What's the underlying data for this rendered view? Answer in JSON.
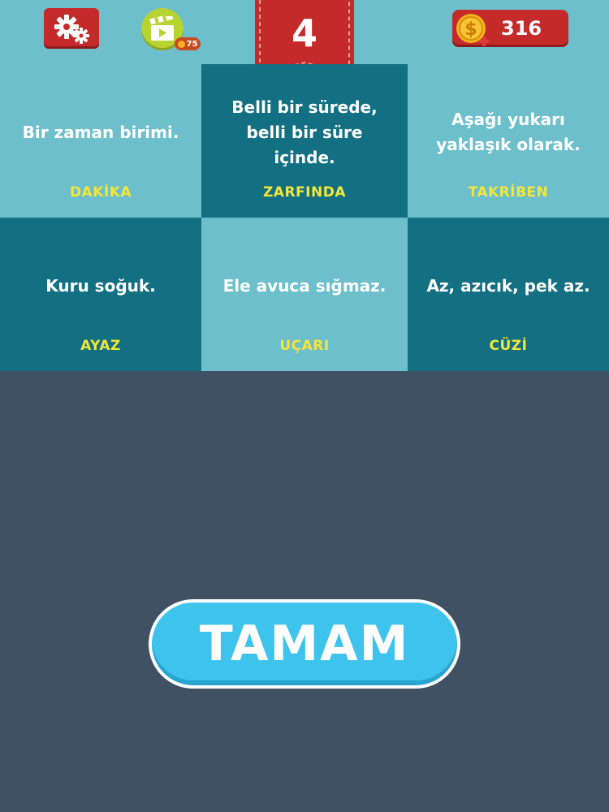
{
  "header": {
    "level": "4",
    "coins": "316",
    "video_reward": "75",
    "colors": {
      "topbar": "#6cbfcb",
      "button_red": "#c42a2a",
      "video_green": "#b8d433",
      "coin_gold": "#f5b21a",
      "badge_orange": "#c84b1e"
    },
    "icons": {
      "settings": "gears-icon",
      "video": "video-clapper-icon",
      "coin": "coin-icon",
      "coin_add": "plus-icon",
      "level": "ribbon-icon"
    }
  },
  "grid": {
    "colors": {
      "light": "#6cbfcb",
      "dark": "#137082",
      "answer": "#f3e63a"
    },
    "cells": [
      {
        "clue": "Bir zaman birimi.",
        "answer": "DAKİKA"
      },
      {
        "clue": "Belli bir sürede, belli bir süre içinde.",
        "answer": "ZARFINDA"
      },
      {
        "clue": "Aşağı yukarı yaklaşık olarak.",
        "answer": "TAKRİBEN"
      },
      {
        "clue": "Kuru soğuk.",
        "answer": "AYAZ"
      },
      {
        "clue": "Ele avuca sığmaz.",
        "answer": "UÇARI"
      },
      {
        "clue": "Az, azıcık, pek az.",
        "answer": "CÜZİ"
      }
    ]
  },
  "footer": {
    "ok_label": "TAMAM",
    "background": "#3f5163",
    "button_color": "#3ec4ec"
  }
}
